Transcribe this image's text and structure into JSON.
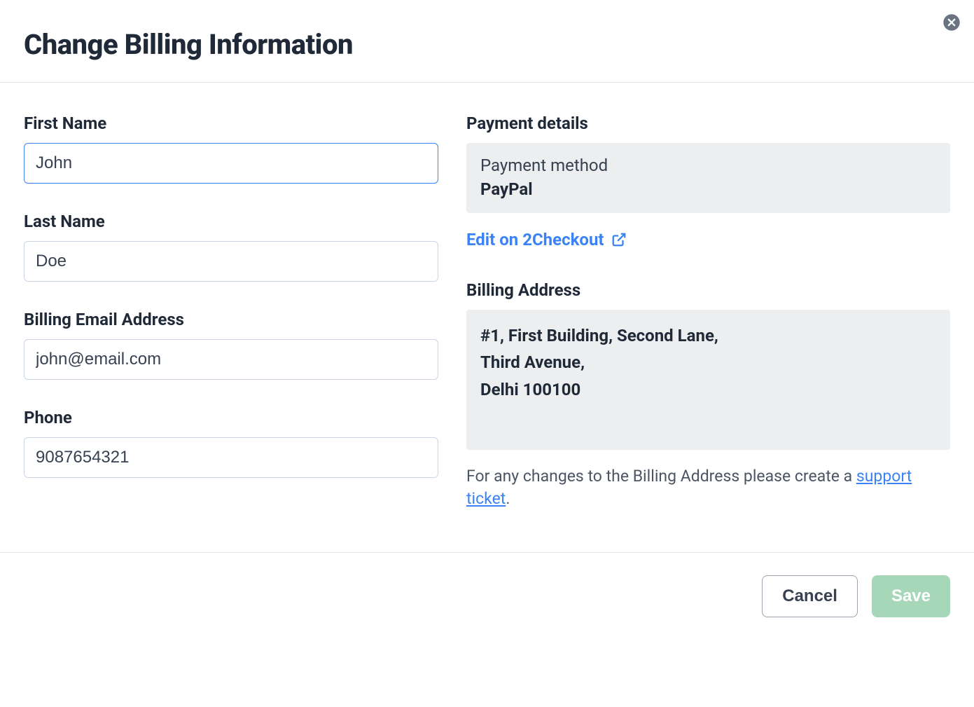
{
  "header": {
    "title": "Change Billing Information"
  },
  "form": {
    "first_name": {
      "label": "First Name",
      "value": "John"
    },
    "last_name": {
      "label": "Last Name",
      "value": "Doe"
    },
    "email": {
      "label": "Billing Email Address",
      "value": "john@email.com"
    },
    "phone": {
      "label": "Phone",
      "value": "9087654321"
    }
  },
  "payment": {
    "section_title": "Payment details",
    "method_label": "Payment method",
    "method_value": "PayPal",
    "edit_link": "Edit on 2Checkout"
  },
  "billing_address": {
    "section_title": "Billing Address",
    "line1": "#1, First Building, Second Lane,",
    "line2": "Third Avenue,",
    "line3": "Delhi 100100",
    "help_prefix": "For any changes to the Billing Address please create a ",
    "support_link": "support ticket",
    "help_suffix": "."
  },
  "footer": {
    "cancel": "Cancel",
    "save": "Save"
  }
}
